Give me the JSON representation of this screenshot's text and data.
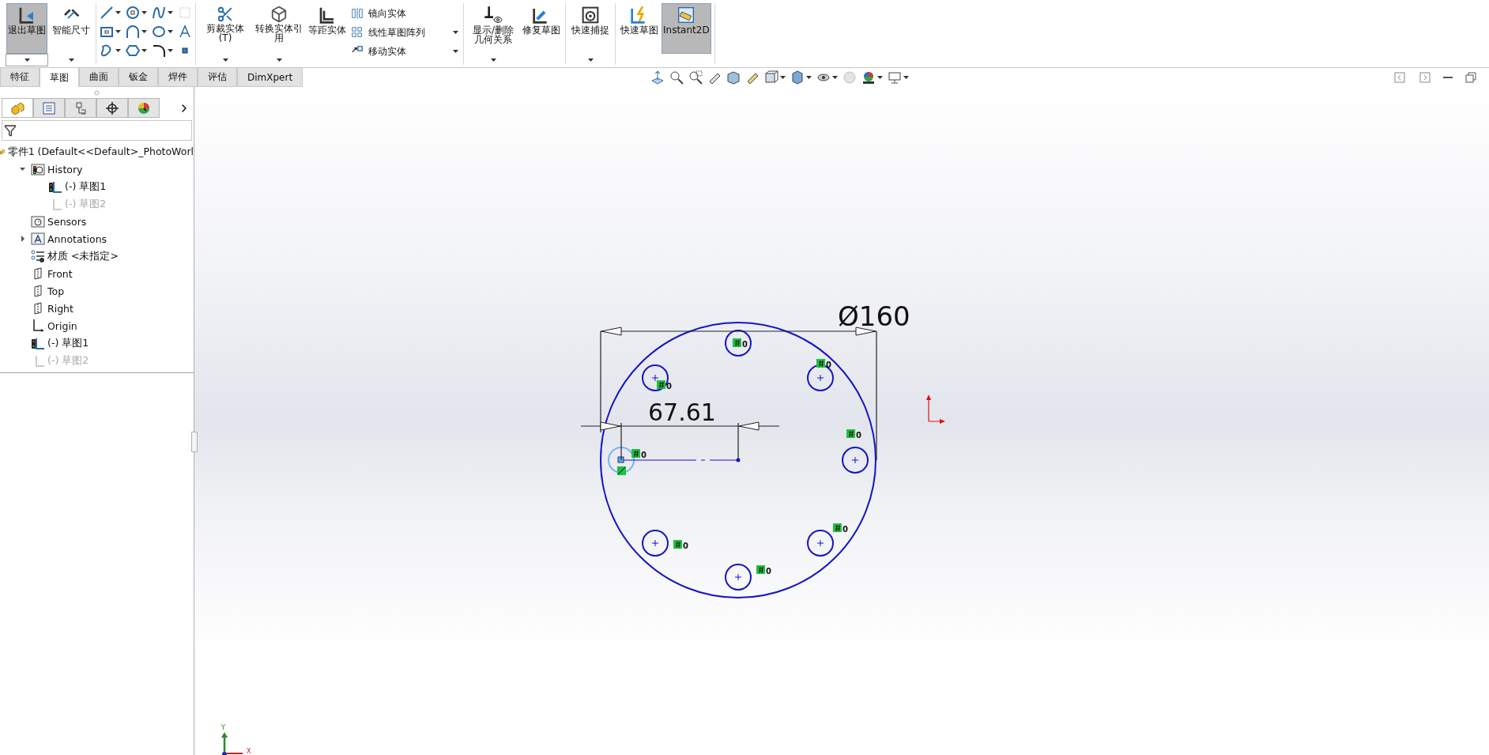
{
  "toolbar_groups": [
    [
      {
        "kind": "large",
        "label": "退出草图",
        "caret": true,
        "selected": true
      },
      {
        "kind": "large",
        "label": "智能尺寸",
        "caret": true,
        "selected": false
      }
    ],
    [
      {
        "kind": "tool_grid"
      }
    ],
    [
      {
        "kind": "large",
        "label": "剪裁实体(T)",
        "caret": true,
        "selected": false
      },
      {
        "kind": "large",
        "label": "转换实体引用",
        "caret": true,
        "selected": false
      },
      {
        "kind": "large",
        "label": "等距实体",
        "caret": false,
        "selected": false
      },
      {
        "kind": "list",
        "entries": [
          {
            "label": "镜向实体",
            "caret": false
          },
          {
            "label": "线性草图阵列",
            "caret": true
          },
          {
            "label": "移动实体",
            "caret": true
          }
        ]
      }
    ],
    [
      {
        "kind": "large",
        "label": "显示/删除几何关系",
        "caret": true,
        "selected": false
      },
      {
        "kind": "large",
        "label": "修复草图",
        "caret": false,
        "selected": false
      }
    ],
    [
      {
        "kind": "large",
        "label": "快速捕捉",
        "caret": true,
        "selected": false
      }
    ],
    [
      {
        "kind": "large",
        "label": "快速草图",
        "caret": false,
        "selected": false
      },
      {
        "kind": "large",
        "label": "Instant2D",
        "caret": false,
        "selected": true
      }
    ]
  ],
  "tabs": [
    {
      "label": "特征",
      "selected": false
    },
    {
      "label": "草图",
      "selected": true
    },
    {
      "label": "曲面",
      "selected": false
    },
    {
      "label": "钣金",
      "selected": false
    },
    {
      "label": "焊件",
      "selected": false
    },
    {
      "label": "评估",
      "selected": false
    },
    {
      "label": "DimXpert",
      "selected": false
    }
  ],
  "panel_tabs": [
    {
      "selected": true
    },
    {
      "selected": false
    },
    {
      "selected": false
    },
    {
      "selected": false
    },
    {
      "selected": false
    }
  ],
  "tree": [
    {
      "kind": "part",
      "label": "零件1  (Default<<Default>_PhotoWorl",
      "dimmed": false,
      "children": [
        {
          "kind": "history",
          "label": "History",
          "dimmed": false,
          "expanded": true,
          "children": [
            {
              "kind": "sketch",
              "label": "(-) 草图1",
              "dimmed": false
            },
            {
              "kind": "sketch",
              "label": "(-) 草图2",
              "dimmed": true
            }
          ]
        },
        {
          "kind": "sensors",
          "label": "Sensors",
          "dimmed": false
        },
        {
          "kind": "annotations",
          "label": "Annotations",
          "dimmed": false,
          "expanded": false
        },
        {
          "kind": "material",
          "label": "材质 <未指定>",
          "dimmed": false
        },
        {
          "kind": "plane",
          "label": "Front",
          "dimmed": false
        },
        {
          "kind": "plane",
          "label": "Top",
          "dimmed": false
        },
        {
          "kind": "plane",
          "label": "Right",
          "dimmed": false
        },
        {
          "kind": "origin",
          "label": "Origin",
          "dimmed": false
        },
        {
          "kind": "sketch",
          "label": "(-) 草图1",
          "dimmed": false
        },
        {
          "kind": "sketch",
          "label": "(-) 草图2",
          "dimmed": true
        }
      ]
    }
  ],
  "sketch": {
    "diameter_dimension": "Ø160",
    "distance_dimension": "67.61",
    "relations": [
      {
        "label": "0"
      },
      {
        "label": "0"
      },
      {
        "label": "0"
      },
      {
        "label": "0"
      },
      {
        "label": "0"
      },
      {
        "label": "0"
      },
      {
        "label": "0"
      },
      {
        "label": "0"
      }
    ],
    "axis_labels": [
      "Y",
      "X"
    ]
  }
}
